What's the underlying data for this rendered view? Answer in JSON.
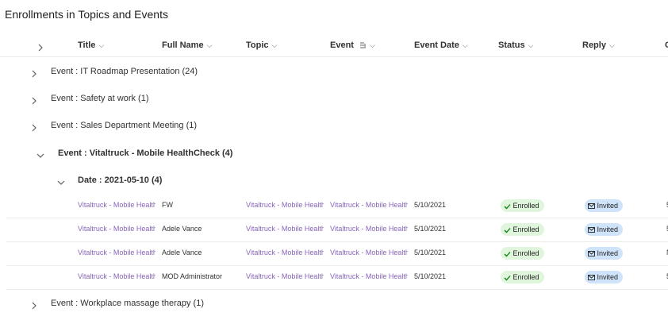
{
  "page_title": "Enrollments in Topics and Events",
  "columns": [
    "Title",
    "Full Name",
    "Topic",
    "Event",
    "Event Date",
    "Status",
    "Reply",
    "C"
  ],
  "groups": [
    {
      "label": "Event : IT Roadmap Presentation (24)"
    },
    {
      "label": "Event : Safety at work (1)"
    },
    {
      "label": "Event : Sales Department Meeting (1)"
    },
    {
      "label": "Event : Vitaltruck - Mobile HealthCheck (4)"
    },
    {
      "label": "Date : 2021-05-10 (4)"
    },
    {
      "label": "Event : Workplace massage therapy (1)"
    }
  ],
  "rows": [
    {
      "title": "Vitaltruck - Mobile HealthCheck",
      "full_name": "FW",
      "topic": "Vitaltruck - Mobile HealthCheck",
      "event": "Vitaltruck - Mobile HealthCheck",
      "date": "5/10/2021",
      "status": "Enrolled",
      "reply": "Invited",
      "extra": "5"
    },
    {
      "title": "Vitaltruck - Mobile HealthCheck",
      "full_name": "Adele Vance",
      "topic": "Vitaltruck - Mobile HealthCheck",
      "event": "Vitaltruck - Mobile HealthCheck",
      "date": "5/10/2021",
      "status": "Enrolled",
      "reply": "Invited",
      "extra": "5"
    },
    {
      "title": "Vitaltruck - Mobile HealthCheck",
      "full_name": "Adele Vance",
      "topic": "Vitaltruck - Mobile HealthCheck",
      "event": "Vitaltruck - Mobile HealthCheck",
      "date": "5/10/2021",
      "status": "Enrolled",
      "reply": "Invited",
      "extra": "N"
    },
    {
      "title": "Vitaltruck - Mobile HealthCheck",
      "full_name": "MOD Administrator",
      "topic": "Vitaltruck - Mobile HealthCheck",
      "event": "Vitaltruck - Mobile HealthCheck",
      "date": "5/10/2021",
      "status": "Enrolled",
      "reply": "Invited",
      "extra": "5"
    }
  ],
  "colors": {
    "link": "#8764b8",
    "enrolled_bg": "#dff6dd",
    "invited_bg": "#cfe4fa"
  }
}
